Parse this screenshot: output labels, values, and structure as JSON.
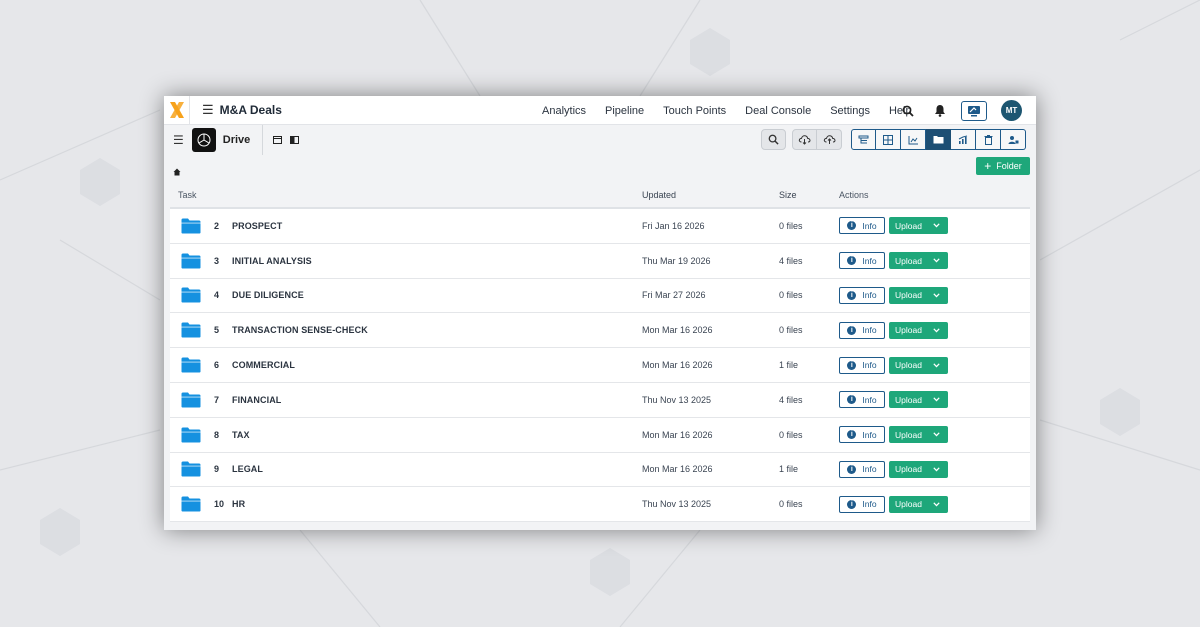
{
  "app": {
    "title": "M&A Deals",
    "logo_icon": "x-logo-icon"
  },
  "nav": {
    "items": [
      {
        "label": "Analytics"
      },
      {
        "label": "Pipeline"
      },
      {
        "label": "Touch Points"
      },
      {
        "label": "Deal Console"
      },
      {
        "label": "Settings"
      },
      {
        "label": "Help"
      }
    ]
  },
  "user": {
    "initials": "MT"
  },
  "drive": {
    "title": "Drive",
    "folder_button": "Folder"
  },
  "table": {
    "headers": {
      "task": "Task",
      "updated": "Updated",
      "size": "Size",
      "actions": "Actions"
    },
    "info_label": "Info",
    "upload_label": "Upload",
    "rows": [
      {
        "num": "2",
        "name": "PROSPECT",
        "updated": "Fri Jan 16 2026",
        "size": "0 files"
      },
      {
        "num": "3",
        "name": "INITIAL ANALYSIS",
        "updated": "Thu Mar 19 2026",
        "size": "4 files"
      },
      {
        "num": "4",
        "name": "DUE DILIGENCE",
        "updated": "Fri Mar 27 2026",
        "size": "0 files"
      },
      {
        "num": "5",
        "name": "TRANSACTION SENSE-CHECK",
        "updated": "Mon Mar 16 2026",
        "size": "0 files"
      },
      {
        "num": "6",
        "name": "COMMERCIAL",
        "updated": "Mon Mar 16 2026",
        "size": "1 file"
      },
      {
        "num": "7",
        "name": "FINANCIAL",
        "updated": "Thu Nov 13 2025",
        "size": "4 files"
      },
      {
        "num": "8",
        "name": "TAX",
        "updated": "Mon Mar 16 2026",
        "size": "0 files"
      },
      {
        "num": "9",
        "name": "LEGAL",
        "updated": "Mon Mar 16 2026",
        "size": "1 file"
      },
      {
        "num": "10",
        "name": "HR",
        "updated": "Thu Nov 13 2025",
        "size": "0 files"
      }
    ]
  },
  "colors": {
    "accent_green": "#1ea77a",
    "accent_blue": "#1e5a8a",
    "folder_blue": "#1591e0",
    "logo_orange": "#f7a21b"
  }
}
